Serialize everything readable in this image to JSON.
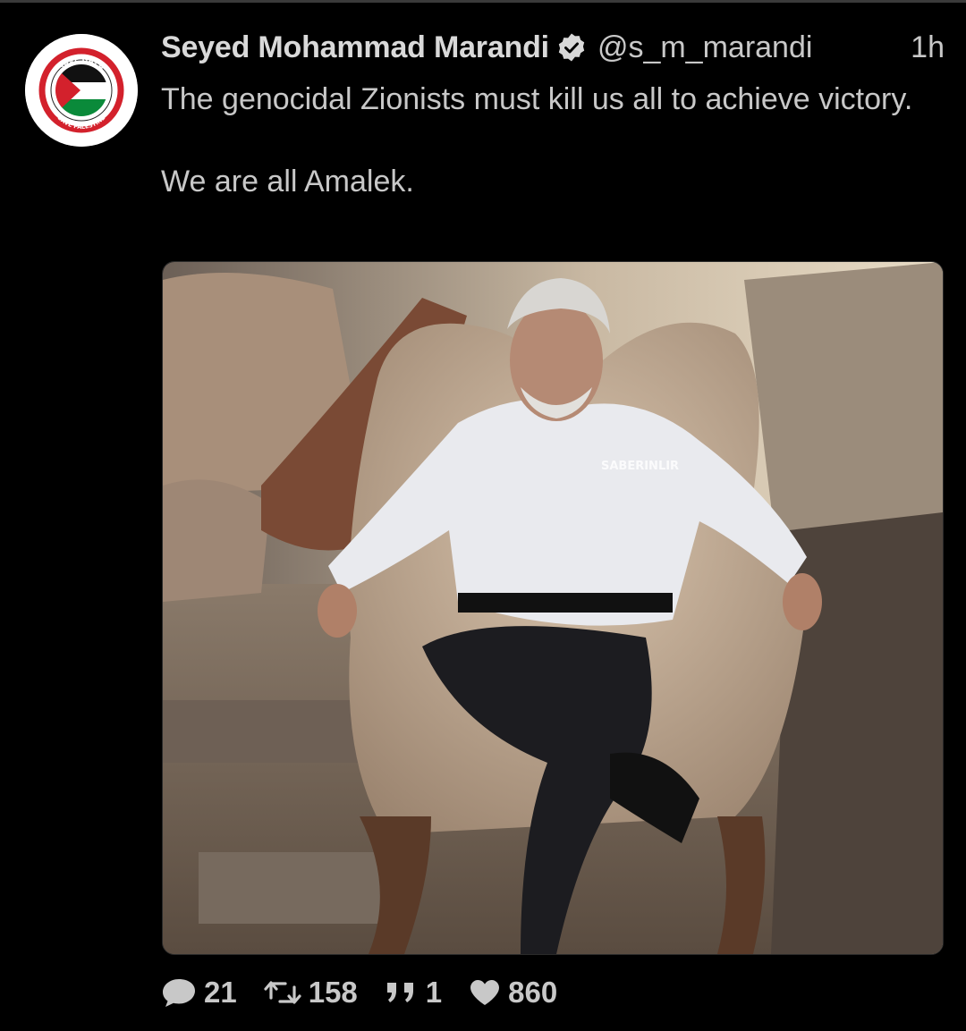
{
  "tweet": {
    "author_name": "Seyed Mohammad Marandi",
    "handle": "@s_m_marandi",
    "time": "1h",
    "verified": true,
    "text_line1": "The genocidal Zionists must kill us all to achieve victory.",
    "text_line2": "We are all Amalek.",
    "avatar": {
      "icon": "save-gaza-palestine-flag-logo",
      "top_text": "SAVE GAZA",
      "bottom_text": "SAVE PALESTINE"
    },
    "media": {
      "watermark": "SABERINLIR"
    }
  },
  "stats": {
    "replies": "21",
    "retweets": "158",
    "quotes": "1",
    "likes": "860"
  },
  "icons": {
    "reply": "comment-bubble-icon",
    "retweet": "retweet-icon",
    "quote": "quote-icon",
    "like": "heart-icon",
    "verified": "verified-check-icon"
  },
  "colors": {
    "background": "#000000",
    "text": "#c8c8c8",
    "flag_red": "#d3212c",
    "flag_green": "#0a8a3a"
  }
}
